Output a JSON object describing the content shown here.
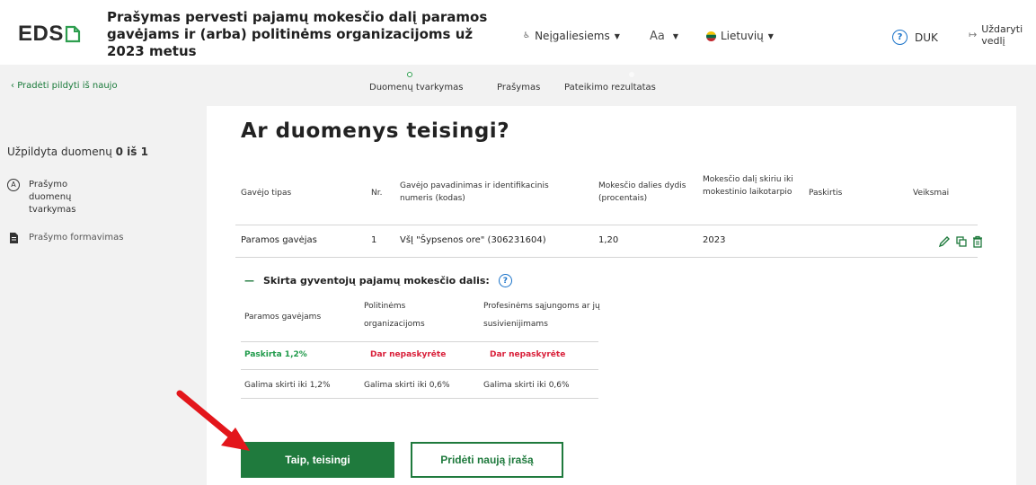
{
  "header": {
    "logo": "EDS",
    "title": "Prašymas pervesti pajamų mokesčio dalį paramos gavėjams ir (arba) politinėms organizacijoms už 2023 metus",
    "accessibility": "Neįgaliesiems",
    "font_size": "Aa",
    "language": "Lietuvių",
    "faq": "DUK",
    "close": "Uždaryti vedlį"
  },
  "subbar": {
    "back": "Pradėti pildyti iš naujo",
    "steps": [
      "Duomenų tvarkymas",
      "Prašymas",
      "Pateikimo rezultatas"
    ]
  },
  "sidebar": {
    "progress_prefix": "Užpildyta duomenų",
    "progress_value": "0 iš 1",
    "items": [
      {
        "badge": "A",
        "label": "Prašymo duomenų tvarkymas"
      },
      {
        "label": "Prašymo formavimas"
      }
    ]
  },
  "main": {
    "title": "Ar duomenys teisingi?",
    "table": {
      "headers": [
        "Gavėjo tipas",
        "Nr.",
        "Gavėjo pavadinimas ir identifikacinis numeris (kodas)",
        "Mokesčio dalies dydis (procentais)",
        "Mokesčio dalį skiriu iki mokestinio laikotarpio",
        "Paskirtis",
        "Veiksmai"
      ],
      "rows": [
        {
          "type": "Paramos gavėjas",
          "nr": "1",
          "name": "VšĮ \"Šypsenos ore\" (306231604)",
          "percent": "1,20",
          "until": "2023",
          "purpose": ""
        }
      ]
    },
    "section": {
      "title": "Skirta gyventojų pajamų mokesčio dalis:",
      "headers": [
        "Paramos gavėjams",
        "Politinėms organizacijoms",
        "Profesinėms sąjungoms ar jų susivienijimams"
      ],
      "assigned": [
        "Paskirta 1,2%",
        "Dar nepaskyrėte",
        "Dar nepaskyrėte"
      ],
      "available": [
        "Galima skirti iki 1,2%",
        "Galima skirti iki 0,6%",
        "Galima skirti iki 0,6%"
      ]
    },
    "buttons": {
      "confirm": "Taip, teisingi",
      "add": "Pridėti naują įrašą"
    }
  },
  "colors": {
    "brand_green": "#1f7a3d",
    "assigned_green": "#1f9a4a",
    "unassigned_red": "#d9203a",
    "help_blue": "#1a73c9",
    "arrow_red": "#e3161b"
  }
}
